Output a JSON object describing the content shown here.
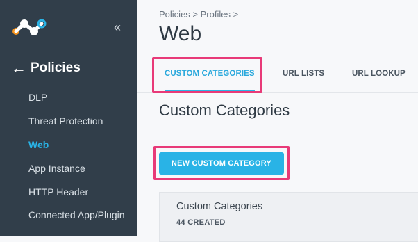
{
  "colors": {
    "sidebar_bg": "#313e4a",
    "accent": "#29b3e6",
    "highlight": "#e83a78",
    "logo_primary": "#f7941d",
    "logo_secondary": "#29b3e6"
  },
  "sidebar": {
    "logo_icon": "app-logo",
    "collapse_icon": "double-chevron-left-icon",
    "collapse_glyph": "«",
    "back_icon": "arrow-left-icon",
    "back_glyph": "←",
    "title": "Policies",
    "items": [
      {
        "label": "DLP",
        "active": false
      },
      {
        "label": "Threat Protection",
        "active": false
      },
      {
        "label": "Web",
        "active": true
      },
      {
        "label": "App Instance",
        "active": false
      },
      {
        "label": "HTTP Header",
        "active": false
      },
      {
        "label": "Connected App/Plugin",
        "active": false
      }
    ]
  },
  "main": {
    "breadcrumb": "Policies > Profiles >",
    "title": "Web",
    "tabs": [
      {
        "label": "CUSTOM CATEGORIES",
        "active": true
      },
      {
        "label": "URL LISTS",
        "active": false
      },
      {
        "label": "URL LOOKUP",
        "active": false
      }
    ],
    "section_title": "Custom Categories",
    "new_button_label": "NEW CUSTOM CATEGORY",
    "card": {
      "title": "Custom Categories",
      "subtitle": "44 CREATED"
    }
  }
}
